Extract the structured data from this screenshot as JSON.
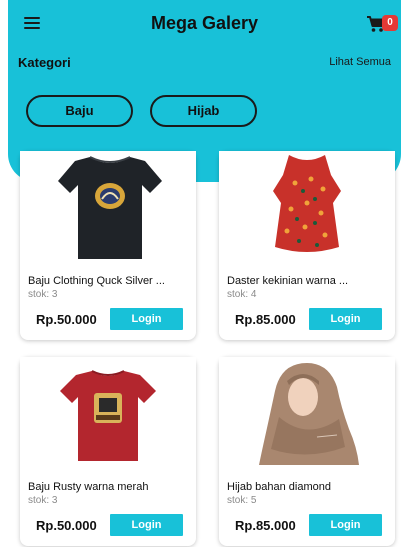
{
  "app": {
    "title": "Mega Galery",
    "cart_count": "0",
    "accent": "#18c1d8"
  },
  "category": {
    "title": "Kategori",
    "see_all": "Lihat Semua",
    "chips": [
      "Baju",
      "Hijab"
    ]
  },
  "products": [
    {
      "name": "Baju Clothing Quck Silver ...",
      "stock": "stok: 3",
      "price": "Rp.50.000",
      "button": "Login",
      "image": "black-tshirt"
    },
    {
      "name": "Daster kekinian warna ...",
      "stock": "stok: 4",
      "price": "Rp.85.000",
      "button": "Login",
      "image": "red-dress"
    },
    {
      "name": "Baju Rusty warna merah",
      "stock": "stok: 3",
      "price": "Rp.50.000",
      "button": "Login",
      "image": "red-tshirt"
    },
    {
      "name": "Hijab bahan diamond",
      "stock": "stok: 5",
      "price": "Rp.85.000",
      "button": "Login",
      "image": "hijab-model"
    }
  ]
}
